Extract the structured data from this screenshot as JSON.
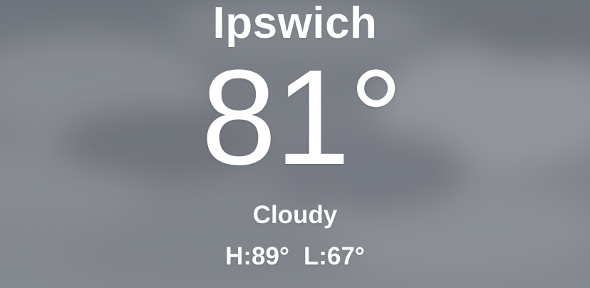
{
  "location": {
    "name": "Ipswich"
  },
  "current": {
    "temperature": "81°",
    "condition": "Cloudy",
    "high": "H:89°",
    "low": "L:67°"
  },
  "theme": {
    "background_base": "#7a7f87",
    "text_color": "#ffffff"
  }
}
